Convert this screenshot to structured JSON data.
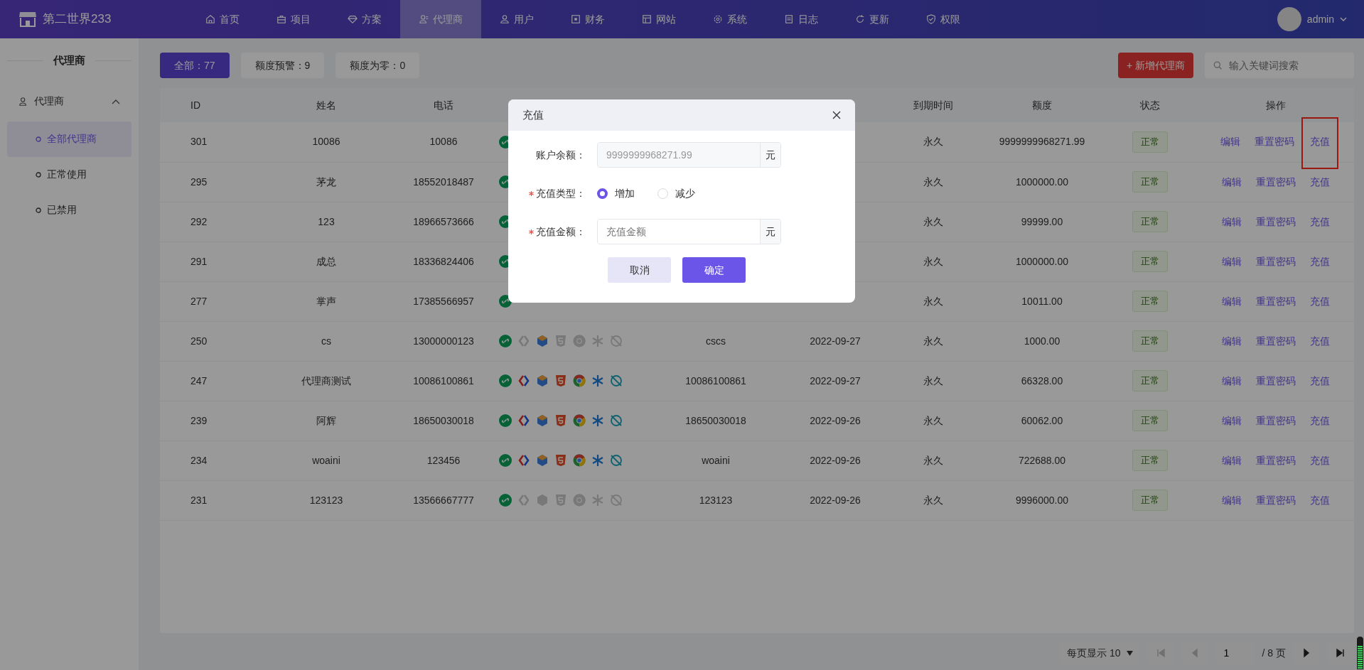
{
  "app": {
    "logo_text": "第二世界233"
  },
  "nav": [
    {
      "label": "首页",
      "selected": false
    },
    {
      "label": "项目",
      "selected": false
    },
    {
      "label": "方案",
      "selected": false
    },
    {
      "label": "代理商",
      "selected": true
    },
    {
      "label": "用户",
      "selected": false
    },
    {
      "label": "财务",
      "selected": false
    },
    {
      "label": "网站",
      "selected": false
    },
    {
      "label": "系统",
      "selected": false
    },
    {
      "label": "日志",
      "selected": false
    },
    {
      "label": "更新",
      "selected": false
    },
    {
      "label": "权限",
      "selected": false
    }
  ],
  "user": {
    "name": "admin"
  },
  "sidebar": {
    "title": "代理商",
    "group": {
      "label": "代理商",
      "expanded": true,
      "children": [
        {
          "label": "全部代理商",
          "selected": true
        },
        {
          "label": "正常使用",
          "selected": false
        },
        {
          "label": "已禁用",
          "selected": false
        }
      ]
    }
  },
  "filters": [
    {
      "label": "全部：77",
      "selected": true
    },
    {
      "label": "额度预警：9",
      "selected": false
    },
    {
      "label": "额度为零：0",
      "selected": false
    }
  ],
  "add_button": "+ 新增代理商",
  "search": {
    "placeholder": "输入关键词搜索"
  },
  "table": {
    "columns_left": [
      "ID",
      "姓名",
      "电话"
    ],
    "columns_right": [
      "到期时间",
      "额度",
      "状态",
      "操作"
    ],
    "rows": [
      {
        "id": "301",
        "name": "10086",
        "phone": "10086",
        "platforms": [
          {
            "kind": "miniapp",
            "enabled": true
          }
        ],
        "expiry": "永久",
        "quota": "9999999968271.99",
        "status": "正常",
        "actions": [
          {
            "label": "编辑",
            "highlighted": false
          },
          {
            "label": "重置密码",
            "highlighted": false
          },
          {
            "label": "充值",
            "highlighted": true
          }
        ]
      },
      {
        "id": "295",
        "name": "茅龙",
        "phone": "18552018487",
        "platforms": [
          {
            "kind": "miniapp",
            "enabled": true
          }
        ],
        "expiry": "永久",
        "quota": "1000000.00",
        "status": "正常",
        "actions": [
          {
            "label": "编辑",
            "highlighted": false
          },
          {
            "label": "重置密码",
            "highlighted": false
          },
          {
            "label": "充值",
            "highlighted": false
          }
        ]
      },
      {
        "id": "292",
        "name": "123",
        "phone": "18966573666",
        "platforms": [
          {
            "kind": "miniapp",
            "enabled": true
          }
        ],
        "expiry": "永久",
        "quota": "99999.00",
        "status": "正常",
        "actions": [
          {
            "label": "编辑",
            "highlighted": false
          },
          {
            "label": "重置密码",
            "highlighted": false
          },
          {
            "label": "充值",
            "highlighted": false
          }
        ]
      },
      {
        "id": "291",
        "name": "成总",
        "phone": "18336824406",
        "platforms": [
          {
            "kind": "miniapp",
            "enabled": true
          }
        ],
        "expiry": "永久",
        "quota": "1000000.00",
        "status": "正常",
        "actions": [
          {
            "label": "编辑",
            "highlighted": false
          },
          {
            "label": "重置密码",
            "highlighted": false
          },
          {
            "label": "充值",
            "highlighted": false
          }
        ]
      },
      {
        "id": "277",
        "name": "掌声",
        "phone": "17385566957",
        "platforms": [
          {
            "kind": "miniapp",
            "enabled": true
          }
        ],
        "expiry": "永久",
        "quota": "10011.00",
        "status": "正常",
        "actions": [
          {
            "label": "编辑",
            "highlighted": false
          },
          {
            "label": "重置密码",
            "highlighted": false
          },
          {
            "label": "充值",
            "highlighted": false
          }
        ]
      },
      {
        "id": "250",
        "name": "cs",
        "phone": "13000000123",
        "platforms": [
          {
            "kind": "miniapp",
            "enabled": true
          },
          {
            "kind": "code",
            "enabled": false
          },
          {
            "kind": "cube",
            "enabled": true
          },
          {
            "kind": "html5",
            "enabled": false
          },
          {
            "kind": "chrome",
            "enabled": false
          },
          {
            "kind": "asterisk",
            "enabled": false
          },
          {
            "kind": "planet",
            "enabled": false
          }
        ],
        "column_5": "cscs",
        "column_6": "2022-09-27",
        "expiry": "永久",
        "quota": "1000.00",
        "status": "正常",
        "actions": [
          {
            "label": "编辑",
            "highlighted": false
          },
          {
            "label": "重置密码",
            "highlighted": false
          },
          {
            "label": "充值",
            "highlighted": false
          }
        ]
      },
      {
        "id": "247",
        "name": "代理商测试",
        "phone": "10086100861",
        "platforms": [
          {
            "kind": "miniapp",
            "enabled": true
          },
          {
            "kind": "code",
            "enabled": true
          },
          {
            "kind": "cube",
            "enabled": true
          },
          {
            "kind": "html5",
            "enabled": true
          },
          {
            "kind": "chrome",
            "enabled": true
          },
          {
            "kind": "asterisk",
            "enabled": true
          },
          {
            "kind": "planet",
            "enabled": true
          }
        ],
        "column_5": "10086100861",
        "column_6": "2022-09-27",
        "expiry": "永久",
        "quota": "66328.00",
        "status": "正常",
        "actions": [
          {
            "label": "编辑",
            "highlighted": false
          },
          {
            "label": "重置密码",
            "highlighted": false
          },
          {
            "label": "充值",
            "highlighted": false
          }
        ]
      },
      {
        "id": "239",
        "name": "阿辉",
        "phone": "18650030018",
        "platforms": [
          {
            "kind": "miniapp",
            "enabled": true
          },
          {
            "kind": "code",
            "enabled": true
          },
          {
            "kind": "cube",
            "enabled": true
          },
          {
            "kind": "html5",
            "enabled": true
          },
          {
            "kind": "chrome",
            "enabled": true
          },
          {
            "kind": "asterisk",
            "enabled": true
          },
          {
            "kind": "planet",
            "enabled": true
          }
        ],
        "column_5": "18650030018",
        "column_6": "2022-09-26",
        "expiry": "永久",
        "quota": "60062.00",
        "status": "正常",
        "actions": [
          {
            "label": "编辑",
            "highlighted": false
          },
          {
            "label": "重置密码",
            "highlighted": false
          },
          {
            "label": "充值",
            "highlighted": false
          }
        ]
      },
      {
        "id": "234",
        "name": "woaini",
        "phone": "123456",
        "platforms": [
          {
            "kind": "miniapp",
            "enabled": true
          },
          {
            "kind": "code",
            "enabled": true
          },
          {
            "kind": "cube",
            "enabled": true
          },
          {
            "kind": "html5",
            "enabled": true
          },
          {
            "kind": "chrome",
            "enabled": true
          },
          {
            "kind": "asterisk",
            "enabled": true
          },
          {
            "kind": "planet",
            "enabled": true
          }
        ],
        "column_5": "woaini",
        "column_6": "2022-09-26",
        "expiry": "永久",
        "quota": "722688.00",
        "status": "正常",
        "actions": [
          {
            "label": "编辑",
            "highlighted": false
          },
          {
            "label": "重置密码",
            "highlighted": false
          },
          {
            "label": "充值",
            "highlighted": false
          }
        ]
      },
      {
        "id": "231",
        "name": "123123",
        "phone": "13566667777",
        "platforms": [
          {
            "kind": "miniapp",
            "enabled": true
          },
          {
            "kind": "code",
            "enabled": false
          },
          {
            "kind": "cube",
            "enabled": false
          },
          {
            "kind": "html5",
            "enabled": false
          },
          {
            "kind": "chrome",
            "enabled": false
          },
          {
            "kind": "asterisk",
            "enabled": false
          },
          {
            "kind": "planet",
            "enabled": false
          }
        ],
        "column_5": "123123",
        "column_6": "2022-09-26",
        "expiry": "永久",
        "quota": "9996000.00",
        "status": "正常",
        "actions": [
          {
            "label": "编辑",
            "highlighted": false
          },
          {
            "label": "重置密码",
            "highlighted": false
          },
          {
            "label": "充值",
            "highlighted": false
          }
        ]
      }
    ]
  },
  "pagination": {
    "page_size": "每页显示 10",
    "buttons_before": [
      {
        "kind": "first",
        "disabled": true
      },
      {
        "kind": "prev",
        "disabled": true
      }
    ],
    "page": "1",
    "total": "/ 8 页",
    "buttons_after": [
      {
        "kind": "next",
        "disabled": false
      },
      {
        "kind": "last",
        "disabled": false
      }
    ]
  },
  "modal": {
    "title": "充值",
    "fields": [
      {
        "kind": "readonly",
        "label": "账户余额：",
        "required": false,
        "value": "9999999968271.99",
        "unit": "元"
      },
      {
        "kind": "radio",
        "label": "充值类型：",
        "required": true,
        "options": [
          {
            "label": "增加",
            "selected": true
          },
          {
            "label": "减少",
            "selected": false
          }
        ]
      },
      {
        "kind": "input",
        "label": "充值金额：",
        "required": true,
        "placeholder": "充值金额",
        "unit": "元"
      }
    ],
    "buttons": [
      {
        "label": "取消",
        "kind": "secondary"
      },
      {
        "label": "确定",
        "kind": "primary"
      }
    ]
  },
  "level_meter": {
    "level": 0.72
  }
}
